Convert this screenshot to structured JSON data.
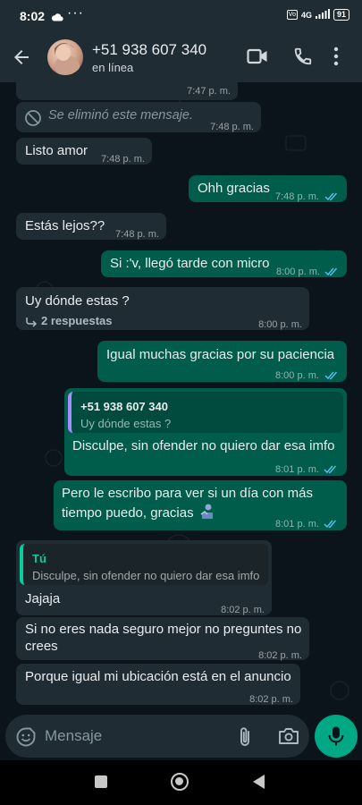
{
  "status_bar": {
    "time": "8:02",
    "dots": "···",
    "network": "4G",
    "battery": "91"
  },
  "header": {
    "contact_name": "+51 938 607 340",
    "contact_status": "en línea"
  },
  "messages": [
    {
      "type": "incoming",
      "text": "",
      "time": "7:47 p. m."
    },
    {
      "type": "incoming",
      "text": "Se eliminó este mensaje.",
      "time": "7:48 p. m.",
      "deleted": true
    },
    {
      "type": "incoming",
      "text": "Listo amor",
      "time": "7:48 p. m."
    },
    {
      "type": "outgoing",
      "text": "Ohh gracias",
      "time": "7:48 p. m."
    },
    {
      "type": "incoming",
      "text": "Estás lejos??",
      "time": "7:48 p. m."
    },
    {
      "type": "outgoing",
      "text": "Si :'v, llegó tarde con micro",
      "time": "8:00 p. m."
    },
    {
      "type": "incoming",
      "text": "Uy dónde estas ?",
      "replies": "2 respuestas",
      "time": "8:00 p. m."
    },
    {
      "type": "outgoing",
      "text": "Igual muchas gracias por su paciencia",
      "time": "8:00 p. m."
    },
    {
      "type": "outgoing",
      "quote_name": "+51 938 607 340",
      "quote_text": "Uy dónde estas ?",
      "text": "Disculpe, sin ofender no quiero dar esa imfo",
      "time": "8:01 p. m."
    },
    {
      "type": "outgoing",
      "text_lines": [
        "Pero le escribo para ver si un día con más",
        "tiempo puedo, gracias"
      ],
      "time": "8:01 p. m."
    },
    {
      "type": "incoming",
      "quote_name": "Tú",
      "quote_text": "Disculpe, sin ofender no quiero dar esa imfo",
      "text": "Jajaja",
      "time": "8:02 p. m."
    },
    {
      "type": "incoming",
      "text_lines": [
        "Si no eres nada seguro mejor no preguntes no",
        "crees"
      ],
      "time": "8:02 p. m."
    },
    {
      "type": "incoming",
      "text": "Porque igual mi ubicación está en el anuncio",
      "time": "8:02 p. m."
    }
  ],
  "input": {
    "placeholder": "Mensaje"
  },
  "colors": {
    "incoming_bubble": "#202c33",
    "outgoing_bubble": "#005c4b",
    "accent": "#00a884",
    "read_ticks": "#53bdeb",
    "quote_bar_outgoing": "#a68cff",
    "quote_bar_incoming": "#06cf9c"
  },
  "icons": [
    "back-arrow-icon",
    "video-call-icon",
    "phone-icon",
    "more-vert-icon",
    "blocked-icon",
    "reply-arrow-icon",
    "double-check-icon",
    "emoji-icon",
    "attach-icon",
    "camera-icon",
    "mic-icon",
    "sticker-emoji-icon"
  ]
}
